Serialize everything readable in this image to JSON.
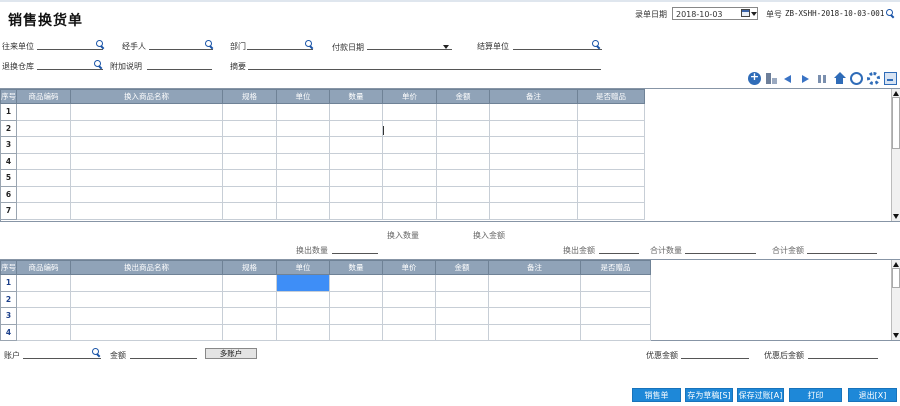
{
  "title": "销售换货单",
  "header": {
    "date_label": "录单日期",
    "date_value": "2018-10-03",
    "orderno_label": "单号",
    "orderno_value": "ZB-XSHH-2018-10-03-001"
  },
  "form": {
    "partner_label": "往来单位",
    "handler_label": "经手人",
    "dept_label": "部门",
    "pay_date_label": "付款日期",
    "settle_label": "结算单位",
    "warehouse_label": "退换仓库",
    "note_label": "附加说明",
    "summary_label": "摘要"
  },
  "toolbar_icons": [
    "add-icon",
    "building-icon",
    "arrow-left-icon",
    "arrow-right-icon",
    "columns-icon",
    "home-icon",
    "refresh-icon",
    "gear-icon",
    "screen-icon"
  ],
  "in_grid": {
    "columns": [
      "序号",
      "商品编码",
      "换入商品名称",
      "规格",
      "单位",
      "数量",
      "单价",
      "金额",
      "备注",
      "是否赠品"
    ],
    "rows": [
      "1",
      "2",
      "3",
      "4",
      "5",
      "6",
      "7"
    ]
  },
  "summary": {
    "in_qty_label": "换入数量",
    "in_amount_label": "换入金额",
    "out_qty_label": "换出数量",
    "out_amount_label": "换出金额",
    "total_qty_label": "合计数量",
    "total_amount_label": "合计金额"
  },
  "out_grid": {
    "columns": [
      "序号",
      "商品编码",
      "换出商品名称",
      "规格",
      "单位",
      "数量",
      "单价",
      "金额",
      "备注",
      "是否赠品"
    ],
    "rows": [
      "1",
      "2",
      "3",
      "4"
    ]
  },
  "footer": {
    "account_label": "账户",
    "amount_label": "金额",
    "multi_account_label": "多账户",
    "discount_label": "优惠金额",
    "after_discount_label": "优惠后金额"
  },
  "buttons": {
    "sales_order": "销售单",
    "save_draft": "存为草稿[S]",
    "save_post": "保存过账[A]",
    "print": "打印",
    "exit": "退出[X]"
  },
  "colors": {
    "header_bg": "#90a3b8",
    "button_bg": "#1e88d8",
    "selected_cell": "#3e8ef7"
  }
}
